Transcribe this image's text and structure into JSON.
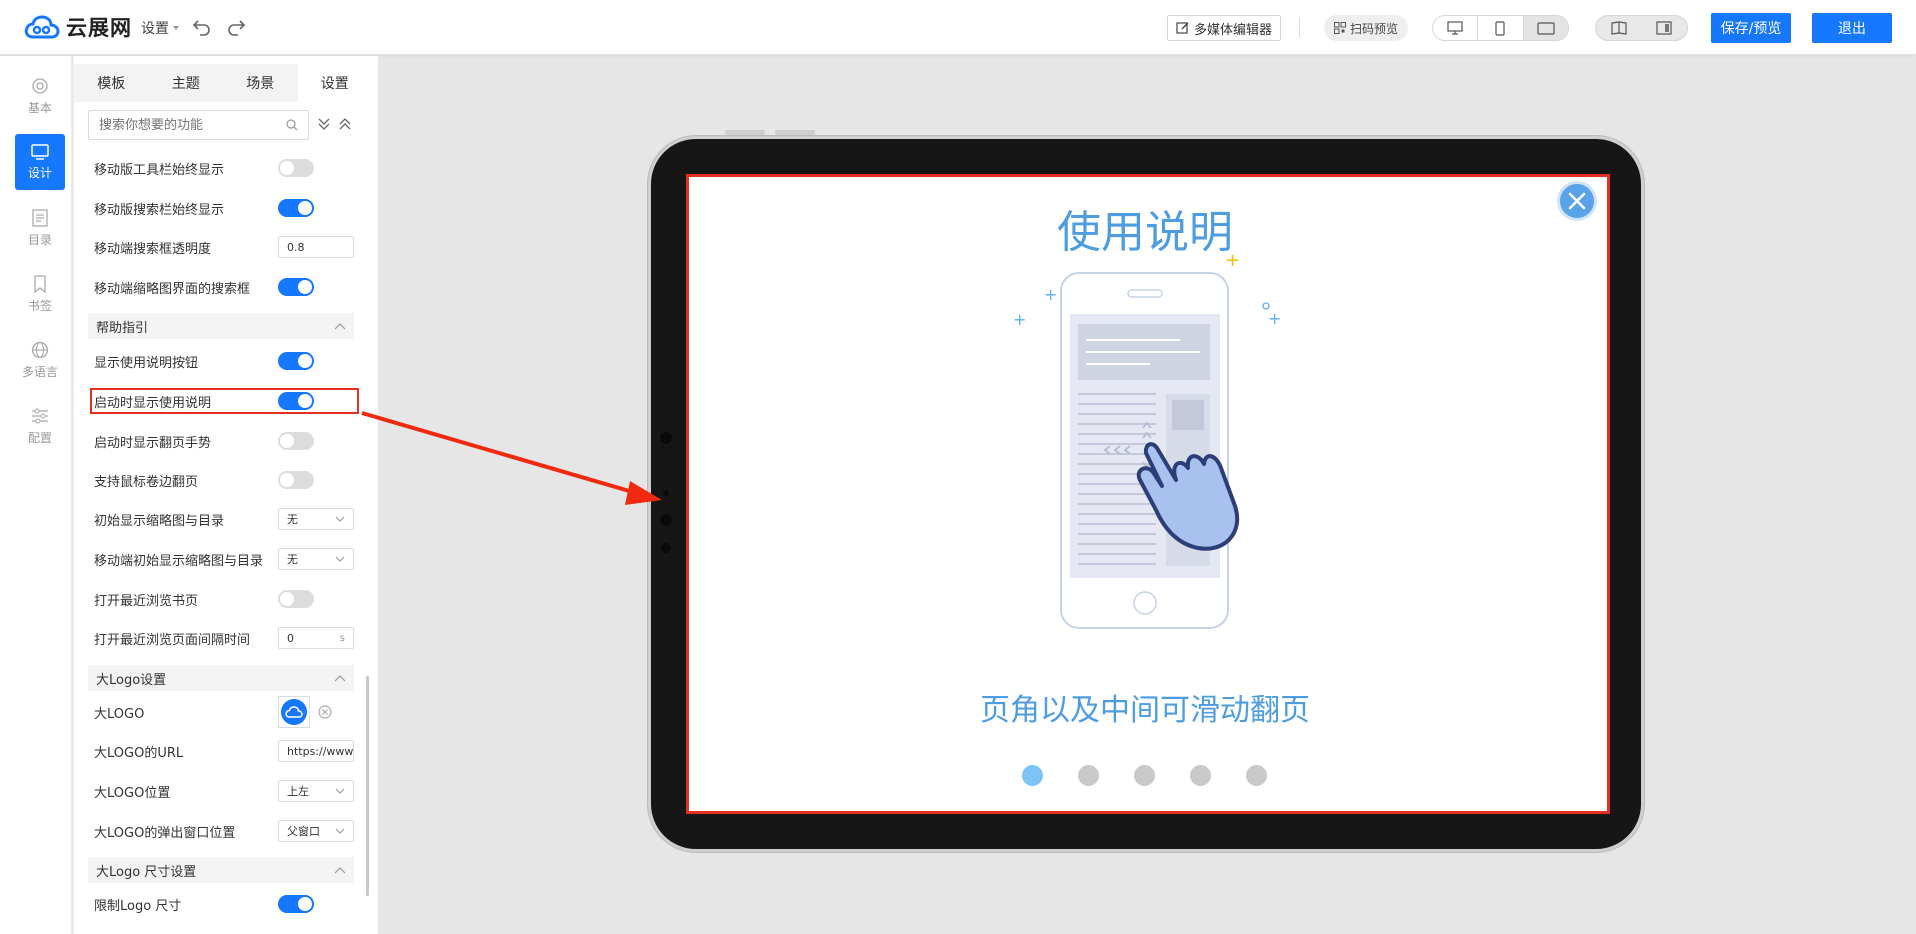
{
  "app": {
    "logo_text": "云展网",
    "settings_menu": "设置"
  },
  "toolbar": {
    "media_editor": "多媒体编辑器",
    "qr_preview": "扫码预览",
    "save_preview": "保存/预览",
    "exit": "退出"
  },
  "leftnav": {
    "items": [
      {
        "label": "基本"
      },
      {
        "label": "设计"
      },
      {
        "label": "目录"
      },
      {
        "label": "书签"
      },
      {
        "label": "多语言"
      },
      {
        "label": "配置"
      }
    ]
  },
  "tabs": [
    {
      "label": "模板"
    },
    {
      "label": "主题"
    },
    {
      "label": "场景"
    },
    {
      "label": "设置"
    }
  ],
  "search": {
    "placeholder": "搜索你想要的功能"
  },
  "settings": {
    "mobile_toolbar_always": "移动版工具栏始终显示",
    "mobile_searchbar_always": "移动版搜索栏始终显示",
    "mobile_search_opacity": "移动端搜索框透明度",
    "mobile_search_opacity_value": "0.8",
    "mobile_thumb_search": "移动端缩略图界面的搜索框",
    "help_section": "帮助指引",
    "show_help_button": "显示使用说明按钮",
    "show_help_on_start": "启动时显示使用说明",
    "show_flip_gesture": "启动时显示翻页手势",
    "mouse_wheel_flip": "支持鼠标卷边翻页",
    "initial_thumb_toc": "初始显示缩略图与目录",
    "initial_thumb_toc_value": "无",
    "mobile_initial_thumb_toc": "移动端初始显示缩略图与目录",
    "mobile_initial_thumb_toc_value": "无",
    "open_recent_page": "打开最近浏览书页",
    "recent_interval": "打开最近浏览页面间隔时间",
    "recent_interval_value": "0",
    "recent_interval_unit": "s",
    "biglogo_section": "大Logo设置",
    "biglogo": "大LOGO",
    "biglogo_url": "大LOGO的URL",
    "biglogo_url_value": "https://www",
    "biglogo_position": "大LOGO位置",
    "biglogo_position_value": "上左",
    "biglogo_popup_position": "大LOGO的弹出窗口位置",
    "biglogo_popup_position_value": "父窗口",
    "logosize_section": "大Logo 尺寸设置",
    "limit_logo_size": "限制Logo 尺寸"
  },
  "toggles": {
    "mobile_toolbar_always": 0,
    "mobile_searchbar_always": 1,
    "mobile_thumb_search": 1,
    "show_help_button": 1,
    "show_help_on_start": 1,
    "show_flip_gesture": 0,
    "mouse_wheel_flip": 0,
    "open_recent_page": 0,
    "limit_logo_size": 1
  },
  "preview": {
    "title": "使用说明",
    "caption": "页角以及中间可滑动翻页",
    "active_dot": 1,
    "dot_count": 5
  },
  "colors": {
    "accent": "#1677ff",
    "highlight": "#e53020",
    "preview_text": "#4e9de0"
  }
}
